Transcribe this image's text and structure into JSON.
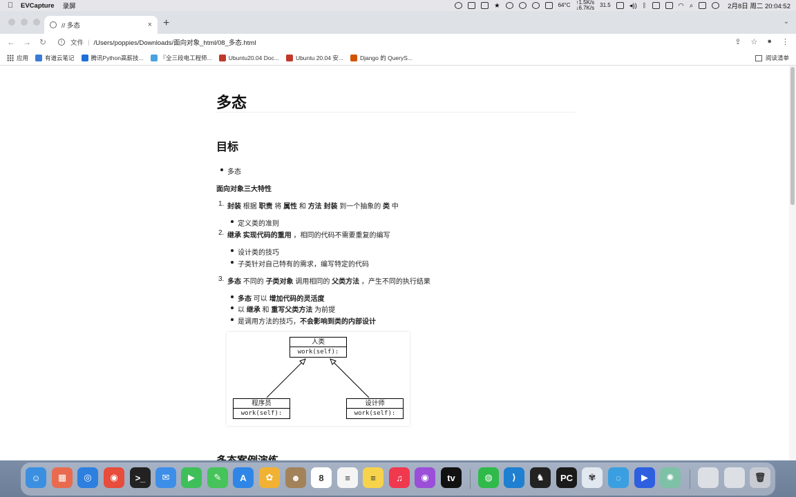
{
  "menubar": {
    "apple_icon": "apple-icon",
    "app_name": "EVCapture",
    "menu_item": "录屏",
    "cpu_temp": "64°C",
    "net_up": "↑1.5K/s",
    "net_down": "↓6.7K/s",
    "battery_percent": "31.5",
    "clock": "2月8日 周二  20:04:52"
  },
  "browser": {
    "tab_title": "// 多态",
    "tab_close": "×",
    "new_tab": "+",
    "omnibox_scheme": "文件",
    "omnibox_url": "/Users/poppies/Downloads/面向对象_html/08_多态.html",
    "bookmarks": [
      {
        "label": "应用",
        "icon": "apps-grid-icon"
      },
      {
        "label": "有道云笔记",
        "icon": "youdao-icon",
        "color": "#3a7bd5"
      },
      {
        "label": "腾讯Python高薪技...",
        "icon": "tencent-icon",
        "color": "#1f6fd6"
      },
      {
        "label": "『全三段电工程师...",
        "icon": "bookmark-b-icon",
        "color": "#4aa3df"
      },
      {
        "label": "Ubuntu20.04 Doc...",
        "icon": "ubuntu-icon",
        "color": "#c0392b"
      },
      {
        "label": "Ubuntu 20.04 安...",
        "icon": "ubuntu-icon",
        "color": "#c0392b"
      },
      {
        "label": "Django 的 QueryS...",
        "icon": "django-icon",
        "color": "#d35400"
      }
    ],
    "reading_list": "阅读清单"
  },
  "doc": {
    "title": "多态",
    "h_goal": "目标",
    "goal_item": "多态",
    "oop_heading": "面向对象三大特性",
    "items": [
      {
        "num": "1.",
        "parts": [
          [
            "b",
            "封装"
          ],
          [
            "t",
            " 根据 "
          ],
          [
            "b",
            "职责"
          ],
          [
            "t",
            " 将 "
          ],
          [
            "b",
            "属性"
          ],
          [
            "t",
            " 和 "
          ],
          [
            "b",
            "方法"
          ],
          [
            "t",
            " "
          ],
          [
            "b",
            "封装"
          ],
          [
            "t",
            " 到一个抽象的 "
          ],
          [
            "b",
            "类"
          ],
          [
            "t",
            " 中"
          ]
        ]
      },
      {
        "num": "2.",
        "parts": [
          [
            "b",
            "继承"
          ],
          [
            "t",
            " "
          ],
          [
            "b",
            "实现代码的重用"
          ],
          [
            "t",
            " ，相同的代码不需要重复的编写"
          ]
        ]
      },
      {
        "num": "3.",
        "parts": [
          [
            "b",
            "多态"
          ],
          [
            "t",
            " 不同的 "
          ],
          [
            "b",
            "子类对象"
          ],
          [
            "t",
            " 调用相同的 "
          ],
          [
            "b",
            "父类方法"
          ],
          [
            "t",
            " ，产生不同的执行结果"
          ]
        ]
      }
    ],
    "sub1": [
      {
        "parts": [
          [
            "t",
            "定义类的准则"
          ]
        ]
      }
    ],
    "sub2": [
      {
        "parts": [
          [
            "t",
            "设计类的技巧"
          ]
        ]
      },
      {
        "parts": [
          [
            "t",
            "子类针对自己特有的需求，编写特定的代码"
          ]
        ]
      }
    ],
    "sub3": [
      {
        "parts": [
          [
            "b",
            "多态"
          ],
          [
            "t",
            " 可以 "
          ],
          [
            "b",
            "增加代码的灵活度"
          ]
        ]
      },
      {
        "parts": [
          [
            "t",
            "以 "
          ],
          [
            "b",
            "继承"
          ],
          [
            "t",
            " 和 "
          ],
          [
            "b",
            "重写父类方法"
          ],
          [
            "t",
            " 为前提"
          ]
        ]
      },
      {
        "parts": [
          [
            "t",
            "是调用方法的技巧，"
          ],
          [
            "b",
            "不会影响到类的内部设计"
          ]
        ]
      }
    ],
    "uml": {
      "parent": {
        "name": "人类",
        "method": "work(self):"
      },
      "child1": {
        "name": "程序员",
        "method": "work(self):"
      },
      "child2": {
        "name": "设计师",
        "method": "work(self):"
      }
    },
    "next_heading": "多态案例演练"
  },
  "dock": [
    {
      "name": "finder-icon",
      "color": "#3b8fe0",
      "glyph": "☺"
    },
    {
      "name": "launchpad-icon",
      "color": "#e86b4f",
      "glyph": "▦"
    },
    {
      "name": "safari-icon",
      "color": "#2d7fe0",
      "glyph": "◎"
    },
    {
      "name": "chrome-icon",
      "color": "#e74c3c",
      "glyph": "◉"
    },
    {
      "name": "terminal-icon",
      "color": "#222222",
      "glyph": ">_"
    },
    {
      "name": "mail-icon",
      "color": "#3d8ee8",
      "glyph": "✉"
    },
    {
      "name": "facetime-icon",
      "color": "#3fbf5a",
      "glyph": "▶"
    },
    {
      "name": "messages-icon",
      "color": "#46c35a",
      "glyph": "✎"
    },
    {
      "name": "appstore-icon",
      "color": "#2f86e6",
      "glyph": "A"
    },
    {
      "name": "photos-icon",
      "color": "#f1b233",
      "glyph": "✿"
    },
    {
      "name": "contacts-icon",
      "color": "#a3825a",
      "glyph": "☻"
    },
    {
      "name": "calendar-icon",
      "color": "#ffffff",
      "glyph": "8"
    },
    {
      "name": "reminders-icon",
      "color": "#f4f4f4",
      "glyph": "≡"
    },
    {
      "name": "notes-icon",
      "color": "#f6d34b",
      "glyph": "≡"
    },
    {
      "name": "music-icon",
      "color": "#f0384f",
      "glyph": "♫"
    },
    {
      "name": "podcasts-icon",
      "color": "#9b4ed8",
      "glyph": "◉"
    },
    {
      "name": "appletv-icon",
      "color": "#111111",
      "glyph": "tv"
    },
    {
      "name": "wechat-icon",
      "color": "#2fba4a",
      "glyph": "◍"
    },
    {
      "name": "vscode-icon",
      "color": "#1f7fd0",
      "glyph": "⟩"
    },
    {
      "name": "qq-icon",
      "color": "#222222",
      "glyph": "♞"
    },
    {
      "name": "pycharm-icon",
      "color": "#1a1a1a",
      "glyph": "PC"
    },
    {
      "name": "netease-icon",
      "color": "#e2e8f0",
      "glyph": "✾"
    },
    {
      "name": "chat-icon",
      "color": "#3a9fe0",
      "glyph": "◌"
    },
    {
      "name": "tencent-meeting-icon",
      "color": "#2d5fe0",
      "glyph": "▶"
    },
    {
      "name": "evcapture-icon",
      "color": "#7ec1a6",
      "glyph": "✺"
    },
    {
      "name": "window-thumb-icon",
      "color": "#dcdfe4",
      "glyph": ""
    },
    {
      "name": "window-thumb2-icon",
      "color": "#dcdfe4",
      "glyph": ""
    },
    {
      "name": "trash-icon",
      "color": "#c8ccd2",
      "glyph": "🗑"
    }
  ]
}
